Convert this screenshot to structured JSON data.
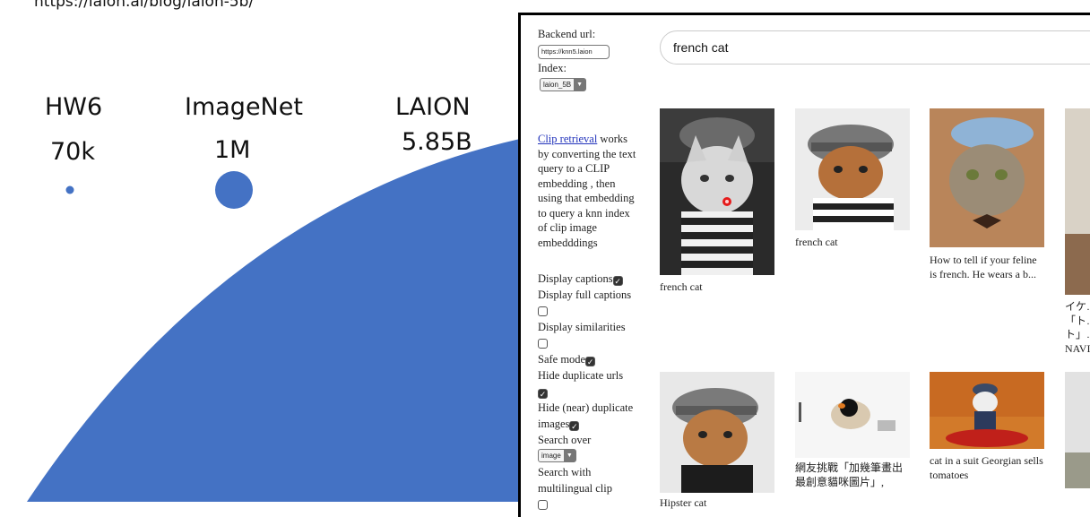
{
  "slide": {
    "source_url": "https://laion.ai/blog/laion-5b/",
    "datasets": [
      {
        "name": "HW6",
        "size": "70k"
      },
      {
        "name": "ImageNet",
        "size": "1M"
      },
      {
        "name": "LAION",
        "size": "5.85B"
      }
    ],
    "circle_color": "#4472c4"
  },
  "app": {
    "backend_label": "Backend url:",
    "backend_value": "https://knn5.laion",
    "index_label": "Index:",
    "index_value": "laion_5B",
    "description_link": "Clip retrieval",
    "description_rest": " works by converting the text query to a CLIP embedding , then using that embedding to query a knn index of clip image embedddings",
    "options": {
      "display_captions": "Display captions",
      "display_full_captions": "Display full captions",
      "display_similarities": "Display similarities",
      "safe_mode": "Safe mode",
      "hide_duplicate_urls": "Hide duplicate urls",
      "hide_near_duplicates": "Hide (near) duplicate images",
      "search_over": "Search over",
      "search_over_value": "image",
      "multilingual": "Search with multilingual clip"
    },
    "search_query": "french cat",
    "results": [
      {
        "caption": "french cat"
      },
      {
        "caption": "french cat"
      },
      {
        "caption": "How to tell if your feline is french. He wears a b..."
      },
      {
        "caption": "イケ…「ト…ト」…NAVI"
      },
      {
        "caption": "Hipster cat"
      },
      {
        "caption": "網友挑戰「加幾筆畫出最創意貓咪圖片」,"
      },
      {
        "caption": "cat in a suit Georgian sells tomatoes"
      }
    ]
  }
}
